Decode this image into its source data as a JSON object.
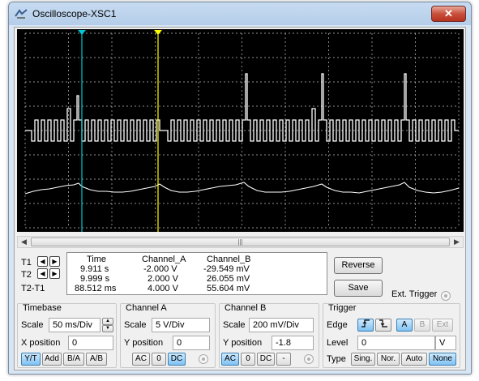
{
  "window": {
    "title": "Oscilloscope-XSC1",
    "close_label": "✕"
  },
  "cursors": {
    "t1_label": "T1",
    "t2_label": "T2",
    "t2t1_label": "T2-T1"
  },
  "readout": {
    "headers": [
      "Time",
      "Channel_A",
      "Channel_B"
    ],
    "rows": [
      [
        "9.911 s",
        "-2.000 V",
        "-29.549 mV"
      ],
      [
        "9.999 s",
        "2.000 V",
        "26.055 mV"
      ],
      [
        "88.512 ms",
        "4.000 V",
        "55.604 mV"
      ]
    ]
  },
  "actions": {
    "reverse": "Reverse",
    "save": "Save",
    "ext_trigger": "Ext. Trigger"
  },
  "timebase": {
    "title": "Timebase",
    "scale_label": "Scale",
    "scale_value": "50 ms/Div",
    "xpos_label": "X position",
    "xpos_value": "0",
    "modes": [
      "Y/T",
      "Add",
      "B/A",
      "A/B"
    ],
    "active_mode": "Y/T"
  },
  "channel_a": {
    "title": "Channel A",
    "scale_label": "Scale",
    "scale_value": "5  V/Div",
    "ypos_label": "Y position",
    "ypos_value": "0",
    "coupling": [
      "AC",
      "0",
      "DC"
    ],
    "active_coupling": "DC"
  },
  "channel_b": {
    "title": "Channel B",
    "scale_label": "Scale",
    "scale_value": "200 mV/Div",
    "ypos_label": "Y position",
    "ypos_value": "-1.8",
    "coupling": [
      "AC",
      "0",
      "DC",
      "-"
    ],
    "active_coupling": "AC"
  },
  "trigger": {
    "title": "Trigger",
    "edge_label": "Edge",
    "sources": [
      "A",
      "B",
      "Ext"
    ],
    "active_source": "A",
    "level_label": "Level",
    "level_value": "0",
    "level_unit": "V",
    "type_label": "Type",
    "types": [
      "Sing.",
      "Nor.",
      "Auto",
      "None"
    ],
    "active_type": "None"
  },
  "colors": {
    "trace_a": "#ffffff",
    "trace_b": "#ffffff",
    "cursor_1": "#00c8d8",
    "cursor_2": "#ffff00",
    "screen": "#000000",
    "grid": "#c0c0c0",
    "active_button": "#7fc1f2"
  }
}
